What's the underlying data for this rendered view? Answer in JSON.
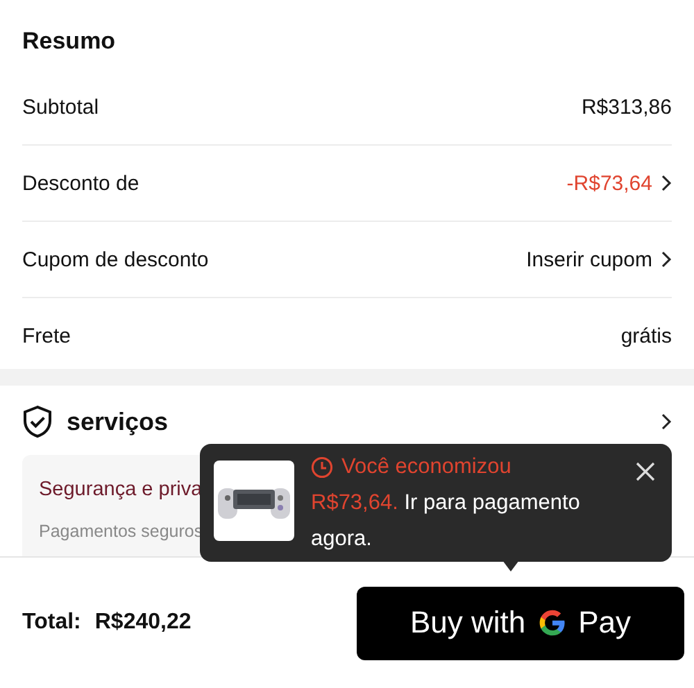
{
  "summary": {
    "title": "Resumo",
    "rows": [
      {
        "label": "Subtotal",
        "value": "R$313,86",
        "kind": "plain"
      },
      {
        "label": "Desconto de",
        "value": "-R$73,64",
        "kind": "discount"
      },
      {
        "label": "Cupom de desconto",
        "value": "Inserir cupom",
        "kind": "link"
      },
      {
        "label": "Frete",
        "value": "grátis",
        "kind": "plain"
      }
    ]
  },
  "services": {
    "title": "serviços",
    "card_title": "Segurança e priva",
    "card_text": "Pagamentos seguros"
  },
  "toast": {
    "headline": "Você economizou",
    "amount": "R$73,64.",
    "message": "Ir para pagamento agora."
  },
  "footer": {
    "total_label": "Total:",
    "total": "R$240,22",
    "pay_button": {
      "before": "Buy with",
      "after": "Pay"
    }
  }
}
